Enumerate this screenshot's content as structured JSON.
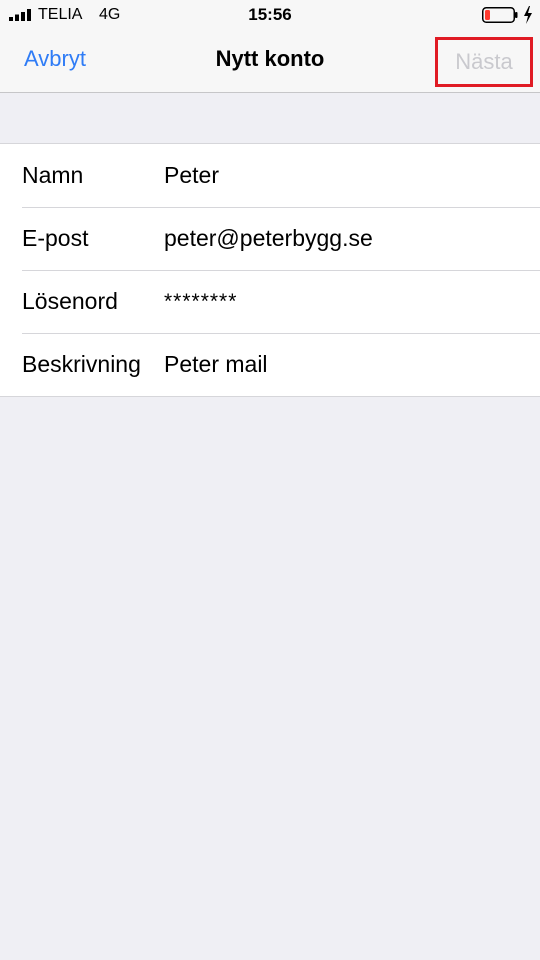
{
  "status_bar": {
    "carrier": "TELIA",
    "network": "4G",
    "time": "15:56"
  },
  "navbar": {
    "cancel_label": "Avbryt",
    "title": "Nytt konto",
    "next_label": "Nästa"
  },
  "form": {
    "rows": [
      {
        "label": "Namn",
        "value": "Peter"
      },
      {
        "label": "E-post",
        "value": "peter@peterbygg.se"
      },
      {
        "label": "Lösenord",
        "value": "********"
      },
      {
        "label": "Beskrivning",
        "value": "Peter mail"
      }
    ]
  },
  "colors": {
    "accent": "#2f7cf6",
    "disabled": "#c9c9ce",
    "highlight": "#e01b24",
    "background": "#efeff4",
    "battery_low": "#ff3b30"
  }
}
